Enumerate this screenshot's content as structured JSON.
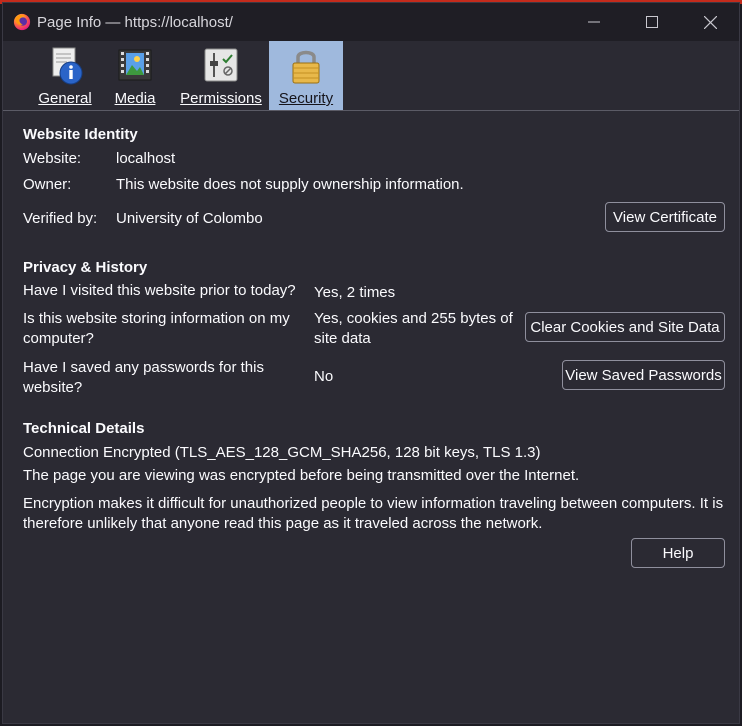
{
  "window": {
    "title": "Page Info — https://localhost/",
    "controls": [
      "minimize",
      "maximize",
      "close"
    ]
  },
  "tabs": [
    {
      "label": "General",
      "icon": "info-icon",
      "selected": false
    },
    {
      "label": "Media",
      "icon": "media-icon",
      "selected": false
    },
    {
      "label": "Permissions",
      "icon": "permissions-icon",
      "selected": false
    },
    {
      "label": "Security",
      "icon": "padlock-icon",
      "selected": true
    }
  ],
  "identity": {
    "title": "Website Identity",
    "website_label": "Website:",
    "website_value": "localhost",
    "owner_label": "Owner:",
    "owner_value": "This website does not supply ownership information.",
    "verified_label": "Verified by:",
    "verified_value": "University of Colombo",
    "view_certificate": "View Certificate"
  },
  "privacy": {
    "title": "Privacy & History",
    "visited_q": "Have I visited this website prior to today?",
    "visited_a": "Yes, 2 times",
    "storing_q": "Is this website storing information on my computer?",
    "storing_a": "Yes, cookies and 255 bytes of site data",
    "clear_button": "Clear Cookies and Site Data",
    "passwords_q": "Have I saved any passwords for this website?",
    "passwords_a": "No",
    "view_passwords_button": "View Saved Passwords"
  },
  "technical": {
    "title": "Technical Details",
    "connection": "Connection Encrypted (TLS_AES_128_GCM_SHA256, 128 bit keys, TLS 1.3)",
    "line1": "The page you are viewing was encrypted before being transmitted over the Internet.",
    "line2": "Encryption makes it difficult for unauthorized people to view information traveling between computers. It is therefore unlikely that anyone read this page as it traveled across the network."
  },
  "help_button": "Help",
  "colors": {
    "background": "#2b2a33",
    "titlebar": "#1f1e25",
    "selected_tab": "#9fb9dd",
    "text": "#fbfbfe",
    "accent_strip": "#c42b1c"
  }
}
